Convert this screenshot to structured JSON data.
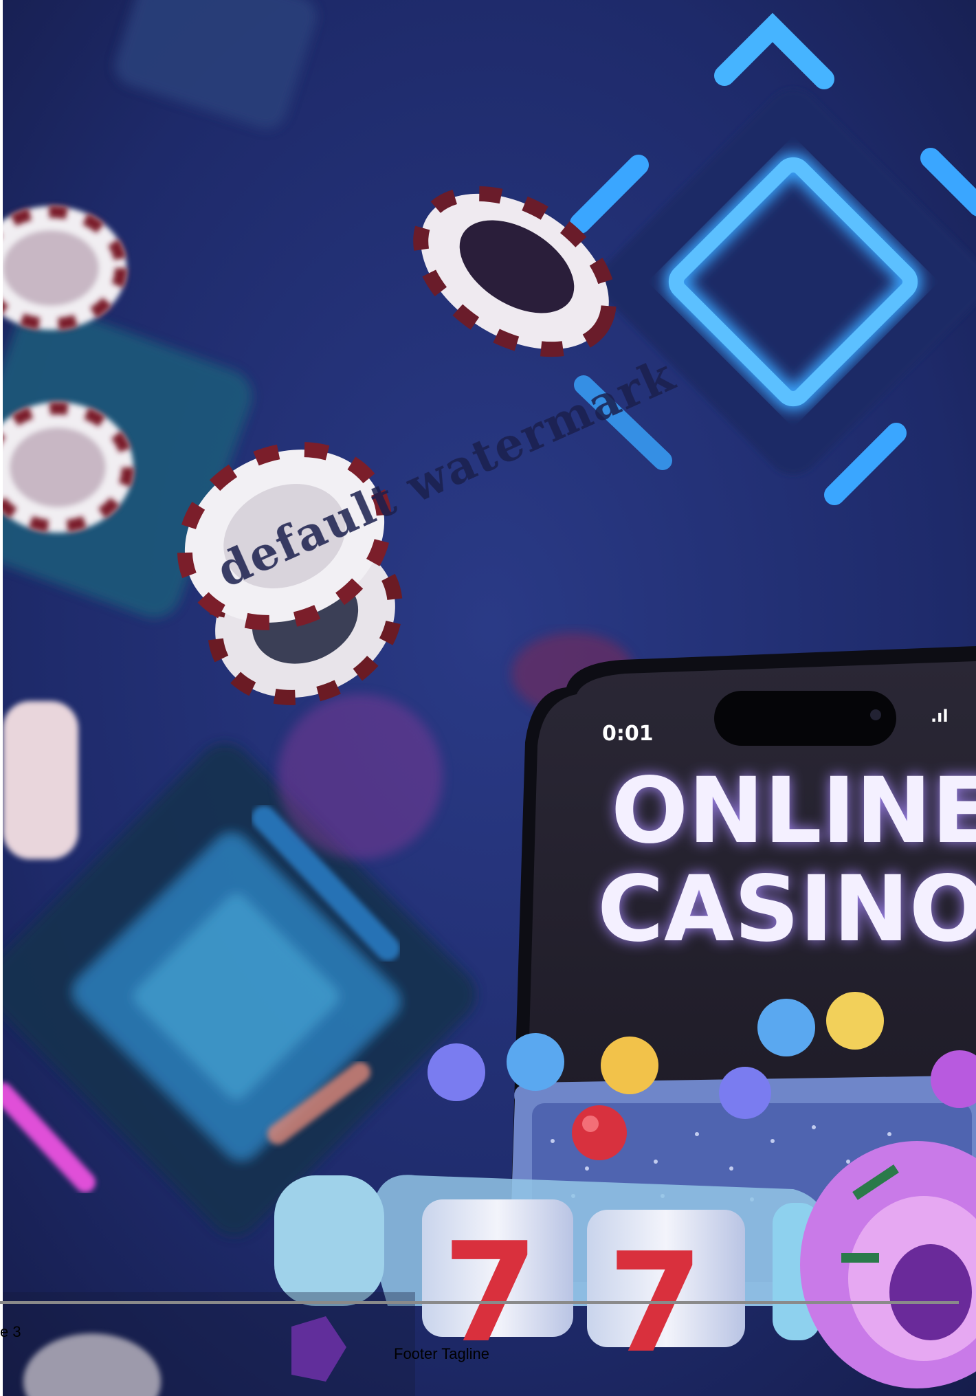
{
  "image": {
    "headline_line1": "ONLINE",
    "headline_line2": "CASINO",
    "status_time": "0:01",
    "colors": {
      "background": "#1c2560",
      "neon_blue": "#3aa6ff",
      "neon_pink": "#e04fd8",
      "headline_glow": "#a98bff",
      "chip_red": "#8a1f2b"
    }
  },
  "watermark": "default watermark",
  "footer": {
    "page_number": "e 3",
    "tagline": "Footer Tagline"
  }
}
